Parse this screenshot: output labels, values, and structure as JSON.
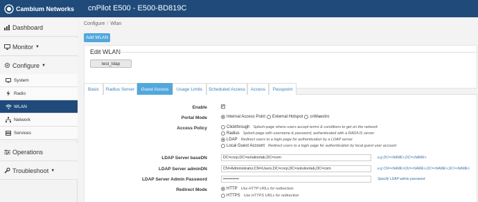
{
  "header": {
    "brand": "Cambium Networks",
    "device_title": "cnPilot E500 - E500-BD819C"
  },
  "sidebar": {
    "dashboard": "Dashboard",
    "monitor": "Monitor",
    "configure": "Configure",
    "system": "System",
    "radio": "Radio",
    "wlan": "WLAN",
    "network": "Network",
    "services": "Services",
    "operations": "Operations",
    "troubleshoot": "Troubleshoot"
  },
  "breadcrumb": {
    "first": "Configure",
    "second": "Wlan"
  },
  "add_wlan": "Add WLAN",
  "edit_panel": {
    "title": "Edit WLAN",
    "wlan_name": "test_ldap"
  },
  "tabs": [
    "Basic",
    "Radius Server",
    "Guest Access",
    "Usage Limits",
    "Scheduled Access",
    "Access",
    "Passpoint"
  ],
  "form": {
    "enable": {
      "label": "Enable",
      "checked": true
    },
    "portal_mode": {
      "label": "Portal Mode",
      "options": [
        "Internal Access Point",
        "External Hotspot",
        "cnMaestro"
      ],
      "selected": "Internal Access Point"
    },
    "access_policy": {
      "label": "Access Policy",
      "options": [
        {
          "name": "Clickthrough",
          "hint": "Splash-page where users accept terms & conditions to get on the network"
        },
        {
          "name": "Radius",
          "hint": "Splash-page with username & password, authenticated with a RADIUS server"
        },
        {
          "name": "LDAP",
          "hint": "Redirect users to a login page for authentication by a LDAP server"
        },
        {
          "name": "Local Guest Account",
          "hint": "Redirect users to a login page for authentication by local guest user account"
        }
      ],
      "selected": "LDAP"
    },
    "base_dn": {
      "label": "LDAP Server baseDN",
      "value": "DC=corp,DC=solutionlab,DC=com",
      "example": "e.g DC=<NAME>,DC=<NAME>"
    },
    "admin_dn": {
      "label": "LDAP Server adminDN",
      "value": "CN=Administrator,CN=Users,DC=corp,DC=solutionlab,DC=com",
      "example": "e.g CN=<NAME>OU=<NAME>,DC=<NAME>,DC=<NAME>"
    },
    "admin_password": {
      "label": "LDAP Server Admin Password",
      "value": "••••••••••••",
      "example": "Specify LDAP admin password"
    },
    "redirect_mode": {
      "label": "Redirect Mode",
      "options": [
        {
          "name": "HTTP",
          "hint": "Use HTTP URLs for redirection"
        },
        {
          "name": "HTTPS",
          "hint": "Use HTTPS URLs for redirection"
        }
      ],
      "selected": "HTTP"
    }
  },
  "colors": {
    "header": "#1f4a7a",
    "accent": "#52a8dc",
    "active_nav": "#1f4a7a"
  }
}
